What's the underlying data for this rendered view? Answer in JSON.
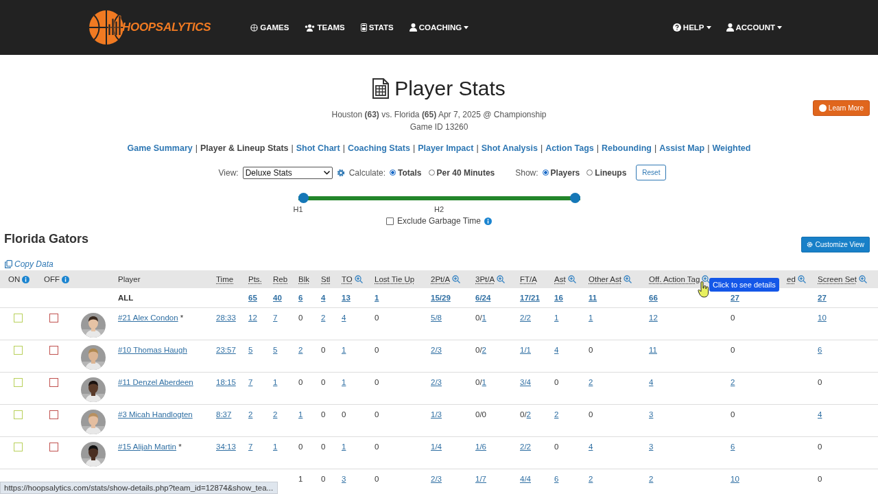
{
  "nav": {
    "brand": "HOOPSALYTICS",
    "items": [
      {
        "label": "GAMES",
        "dropdown": false
      },
      {
        "label": "TEAMS",
        "dropdown": false
      },
      {
        "label": "STATS",
        "dropdown": false
      },
      {
        "label": "COACHING",
        "dropdown": true
      }
    ],
    "right_items": [
      {
        "label": "HELP",
        "dropdown": true
      },
      {
        "label": "ACCOUNT",
        "dropdown": true
      }
    ]
  },
  "header": {
    "title": "Player Stats",
    "learn_more": "Learn More",
    "matchup": "Houston **(63)** vs. Florida **(65)** Apr 7, 2025 @ Championship",
    "game_id": "Game ID 13260"
  },
  "separator": "|",
  "tabs": [
    {
      "label": "Game Summary",
      "selected": false
    },
    {
      "label": "Player & Lineup Stats",
      "selected": true
    },
    {
      "label": "Shot Chart",
      "selected": false
    },
    {
      "label": "Coaching Stats",
      "selected": false
    },
    {
      "label": "Player Impact",
      "selected": false
    },
    {
      "label": "Shot Analysis",
      "selected": false
    },
    {
      "label": "Action Tags",
      "selected": false
    },
    {
      "label": "Rebounding",
      "selected": false
    },
    {
      "label": "Assist Map",
      "selected": false
    },
    {
      "label": "Weighted",
      "selected": false
    }
  ],
  "controls": {
    "view_label": "View:",
    "view_value": "Deluxe Stats",
    "calculate_label": "Calculate:",
    "calculate_options": [
      {
        "label": "Totals",
        "selected": true
      },
      {
        "label": "Per 40 Minutes",
        "selected": false
      }
    ],
    "show_label": "Show:",
    "show_options": [
      {
        "label": "Players",
        "selected": true
      },
      {
        "label": "Lineups",
        "selected": false
      }
    ],
    "reset": "Reset"
  },
  "slider": {
    "level": 1,
    "labels": [
      "H1",
      "H2"
    ]
  },
  "exclude": {
    "label": "Exclude Garbage Time",
    "checked": false
  },
  "team": "Florida Gators",
  "customize": "Customize View",
  "copy": "Copy Data",
  "columns": [
    {
      "label": "ON",
      "kind": "toggle",
      "abbr": false,
      "zoom": false
    },
    {
      "label": "OFF",
      "kind": "toggle",
      "abbr": false,
      "zoom": false
    },
    {
      "label": "Player",
      "kind": "player",
      "abbr": false,
      "zoom": false
    },
    {
      "label": "Time",
      "kind": "stat",
      "abbr": true,
      "zoom": false
    },
    {
      "label": "Pts.",
      "kind": "stat",
      "abbr": true,
      "zoom": false
    },
    {
      "label": "Reb",
      "kind": "stat",
      "abbr": true,
      "zoom": false
    },
    {
      "label": "Blk",
      "kind": "stat",
      "abbr": true,
      "zoom": false
    },
    {
      "label": "Stl",
      "kind": "stat",
      "abbr": true,
      "zoom": false
    },
    {
      "label": "TO",
      "kind": "stat",
      "abbr": true,
      "zoom": true
    },
    {
      "label": "Lost Tie Up",
      "kind": "stat",
      "abbr": true,
      "zoom": false
    },
    {
      "label": "2Pt/A",
      "kind": "stat",
      "abbr": true,
      "zoom": true
    },
    {
      "label": "3Pt/A",
      "kind": "stat",
      "abbr": true,
      "zoom": true
    },
    {
      "label": "FT/A",
      "kind": "stat",
      "abbr": true,
      "zoom": false
    },
    {
      "label": "Ast",
      "kind": "stat",
      "abbr": true,
      "zoom": true
    },
    {
      "label": "Other Ast",
      "kind": "stat",
      "abbr": true,
      "zoom": true
    },
    {
      "label": "Off. Action Tag",
      "kind": "stat",
      "abbr": true,
      "zoom": true
    },
    {
      "label": "ed",
      "kind": "stat",
      "abbr": true,
      "zoom": true
    },
    {
      "label": "Screen Set",
      "kind": "stat",
      "abbr": true,
      "zoom": true
    }
  ],
  "totals": {
    "label": "ALL",
    "cells": [
      null,
      {
        "text": "65",
        "link": true
      },
      {
        "text": "40",
        "link": true
      },
      {
        "text": "6",
        "link": true
      },
      {
        "text": "4",
        "link": true
      },
      {
        "text": "13",
        "link": true
      },
      {
        "text": "1",
        "link": true
      },
      {
        "text": "15/29",
        "link": true
      },
      {
        "text": "6/24",
        "link": true
      },
      {
        "text": "17/21",
        "link": true
      },
      {
        "text": "16",
        "link": true
      },
      {
        "text": "11",
        "link": true
      },
      {
        "text": "66",
        "link": true
      },
      {
        "text": "27",
        "link": true
      },
      {
        "text": "27",
        "link": true
      }
    ]
  },
  "rows": [
    {
      "player": "#21 Alex Condon",
      "note": "*",
      "on_checked": false,
      "off_checked": false,
      "cells": [
        {
          "text": "28:33",
          "link": true
        },
        {
          "text": "12",
          "link": true
        },
        {
          "text": "7",
          "link": true
        },
        {
          "text": "0",
          "link": false
        },
        {
          "text": "2",
          "link": true
        },
        {
          "text": "4",
          "link": true
        },
        {
          "text": "0",
          "link": false
        },
        {
          "text": "5/8",
          "link": true
        },
        {
          "parts": [
            {
              "text": "0/",
              "link": false
            },
            {
              "text": "1",
              "link": true
            }
          ]
        },
        {
          "text": "2/2",
          "link": true
        },
        {
          "text": "1",
          "link": true
        },
        {
          "text": "1",
          "link": true
        },
        {
          "text": "12",
          "link": true
        },
        {
          "text": "0",
          "link": false
        },
        {
          "text": "10",
          "link": true
        }
      ]
    },
    {
      "player": "#10 Thomas Haugh",
      "on_checked": false,
      "off_checked": false,
      "cells": [
        {
          "text": "23:57",
          "link": true
        },
        {
          "text": "5",
          "link": true
        },
        {
          "text": "5",
          "link": true
        },
        {
          "text": "2",
          "link": true
        },
        {
          "text": "0",
          "link": false
        },
        {
          "text": "1",
          "link": true
        },
        {
          "text": "0",
          "link": false
        },
        {
          "text": "2/3",
          "link": true
        },
        {
          "parts": [
            {
              "text": "0/",
              "link": false
            },
            {
              "text": "2",
              "link": true
            }
          ]
        },
        {
          "text": "1/1",
          "link": true
        },
        {
          "text": "4",
          "link": true
        },
        {
          "text": "0",
          "link": false
        },
        {
          "text": "11",
          "link": true
        },
        {
          "text": "0",
          "link": false
        },
        {
          "text": "6",
          "link": true
        }
      ]
    },
    {
      "player": "#11 Denzel Aberdeen",
      "on_checked": false,
      "off_checked": false,
      "cells": [
        {
          "text": "18:15",
          "link": true
        },
        {
          "text": "7",
          "link": true
        },
        {
          "text": "1",
          "link": true
        },
        {
          "text": "0",
          "link": false
        },
        {
          "text": "0",
          "link": false
        },
        {
          "text": "1",
          "link": true
        },
        {
          "text": "0",
          "link": false
        },
        {
          "text": "2/3",
          "link": true
        },
        {
          "parts": [
            {
              "text": "0/",
              "link": false
            },
            {
              "text": "1",
              "link": true
            }
          ]
        },
        {
          "text": "3/4",
          "link": true
        },
        {
          "text": "0",
          "link": false
        },
        {
          "text": "2",
          "link": true
        },
        {
          "text": "4",
          "link": true
        },
        {
          "text": "2",
          "link": true
        },
        {
          "text": "0",
          "link": false
        }
      ]
    },
    {
      "player": "#3 Micah Handlogten",
      "on_checked": false,
      "off_checked": false,
      "cells": [
        {
          "text": "8:37",
          "link": true
        },
        {
          "text": "2",
          "link": true
        },
        {
          "text": "2",
          "link": true
        },
        {
          "text": "1",
          "link": true
        },
        {
          "text": "0",
          "link": false
        },
        {
          "text": "0",
          "link": false
        },
        {
          "text": "0",
          "link": false
        },
        {
          "text": "1/3",
          "link": true
        },
        {
          "text": "0/0",
          "link": false
        },
        {
          "parts": [
            {
              "text": "0/",
              "link": false
            },
            {
              "text": "2",
              "link": true
            }
          ]
        },
        {
          "text": "2",
          "link": true
        },
        {
          "text": "0",
          "link": false
        },
        {
          "text": "3",
          "link": true
        },
        {
          "text": "0",
          "link": false
        },
        {
          "text": "4",
          "link": true
        }
      ]
    },
    {
      "player": "#15 Alijah Martin",
      "note": "*",
      "on_checked": false,
      "off_checked": false,
      "cells": [
        {
          "text": "34:13",
          "link": true
        },
        {
          "text": "7",
          "link": true
        },
        {
          "text": "1",
          "link": true
        },
        {
          "text": "0",
          "link": false
        },
        {
          "text": "0",
          "link": false
        },
        {
          "text": "1",
          "link": true
        },
        {
          "text": "0",
          "link": false
        },
        {
          "text": "1/4",
          "link": true
        },
        {
          "text": "1/6",
          "link": true
        },
        {
          "text": "2/2",
          "link": true
        },
        {
          "text": "0",
          "link": false
        },
        {
          "text": "4",
          "link": true
        },
        {
          "text": "3",
          "link": true
        },
        {
          "text": "6",
          "link": true
        },
        {
          "text": "0",
          "link": false
        }
      ]
    },
    {
      "cells": [
        null,
        null,
        null,
        {
          "text": "1",
          "link": false
        },
        {
          "text": "0",
          "link": false
        },
        {
          "text": "3",
          "link": true
        },
        {
          "text": "0",
          "link": false
        },
        {
          "text": "2/3",
          "link": true
        },
        {
          "text": "1/7",
          "link": true
        },
        {
          "text": "4/4",
          "link": true
        },
        {
          "text": "6",
          "link": true
        },
        {
          "text": "2",
          "link": true
        },
        {
          "text": "2",
          "link": true
        },
        {
          "text": "10",
          "link": true
        },
        {
          "text": "0",
          "link": false
        }
      ]
    }
  ],
  "tooltip": "Click to see details",
  "status_bar": "https://hoopsalytics.com/stats/show-details.php?team_id=12874&show_tea..."
}
